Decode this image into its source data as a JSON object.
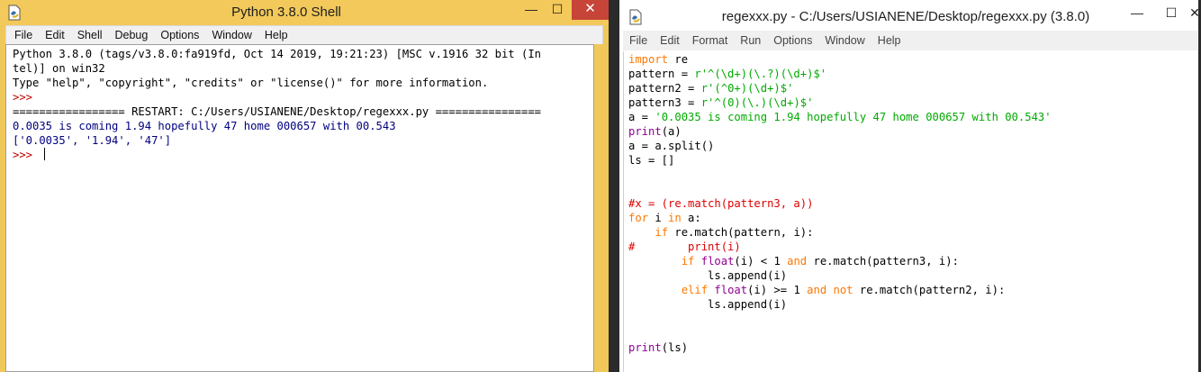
{
  "colors": {
    "shell_titlebar": "#f2c95a",
    "close_button": "#c74438",
    "keyword": "#ff7700",
    "string": "#00aa00",
    "builtin": "#900090",
    "comment": "#dd0000",
    "output": "#000080",
    "prompt": "#c00000"
  },
  "shell": {
    "title": "Python 3.8.0 Shell",
    "icon": "python-icon",
    "controls": {
      "minimize": "—",
      "maximize": "☐",
      "close": "✕"
    },
    "menu": [
      "File",
      "Edit",
      "Shell",
      "Debug",
      "Options",
      "Window",
      "Help"
    ],
    "lines": {
      "l1": "Python 3.8.0 (tags/v3.8.0:fa919fd, Oct 14 2019, 19:21:23) [MSC v.1916 32 bit (In",
      "l2": "tel)] on win32",
      "l3": "Type \"help\", \"copyright\", \"credits\" or \"license()\" for more information.",
      "prompt": ">>> ",
      "restart": "================= RESTART: C:/Users/USIANENE/Desktop/regexxx.py ================",
      "out1": "0.0035 is coming 1.94 hopefully 47 home 000657 with 00.543",
      "out2": "['0.0035', '1.94', '47']"
    }
  },
  "editor": {
    "title": "regexxx.py - C:/Users/USIANENE/Desktop/regexxx.py (3.8.0)",
    "icon": "python-file-icon",
    "controls": {
      "minimize": "—",
      "maximize": "☐",
      "close": "✕"
    },
    "menu": [
      "File",
      "Edit",
      "Format",
      "Run",
      "Options",
      "Window",
      "Help"
    ],
    "code": {
      "import_kw": "import",
      "import_mod": " re",
      "p1_lhs": "pattern = ",
      "p1_str": "r'^(\\d+)(\\.?)(\\d+)$'",
      "p2_lhs": "pattern2 = ",
      "p2_str": "r'(^0+)(\\d+)$'",
      "p3_lhs": "pattern3 = ",
      "p3_str": "r'^(0)(\\.)(\\d+)$'",
      "a_lhs": "a = ",
      "a_str": "'0.0035 is coming 1.94 hopefully 47 home 000657 with 00.543'",
      "print_fn": "print",
      "print_arg": "(a)",
      "split_line": "a = a.split()",
      "ls_line": "ls = []",
      "comment1": "#x = (re.match(pattern3, a))",
      "for_kw": "for",
      "for_mid": " i ",
      "in_kw": "in",
      "for_tail": " a:",
      "if_indent": "    ",
      "if_kw": "if",
      "if_tail": " re.match(pattern, i):",
      "comment2": "#        print(i)",
      "if2_indent": "        ",
      "if2_kw": "if",
      "float_fn": "float",
      "if2_mid": "(i) < 1 ",
      "and_kw": "and",
      "if2_tail": " re.match(pattern3, i):",
      "append1": "            ls.append(i)",
      "elif_indent": "        ",
      "elif_kw": "elif",
      "float2_fn": "float",
      "elif_mid": "(i) >= 1 ",
      "and2_kw": "and",
      "not_kw": "not",
      "elif_tail": " re.match(pattern2, i):",
      "append2": "            ls.append(i)",
      "print2_fn": "print",
      "print2_arg": "(ls)"
    }
  }
}
